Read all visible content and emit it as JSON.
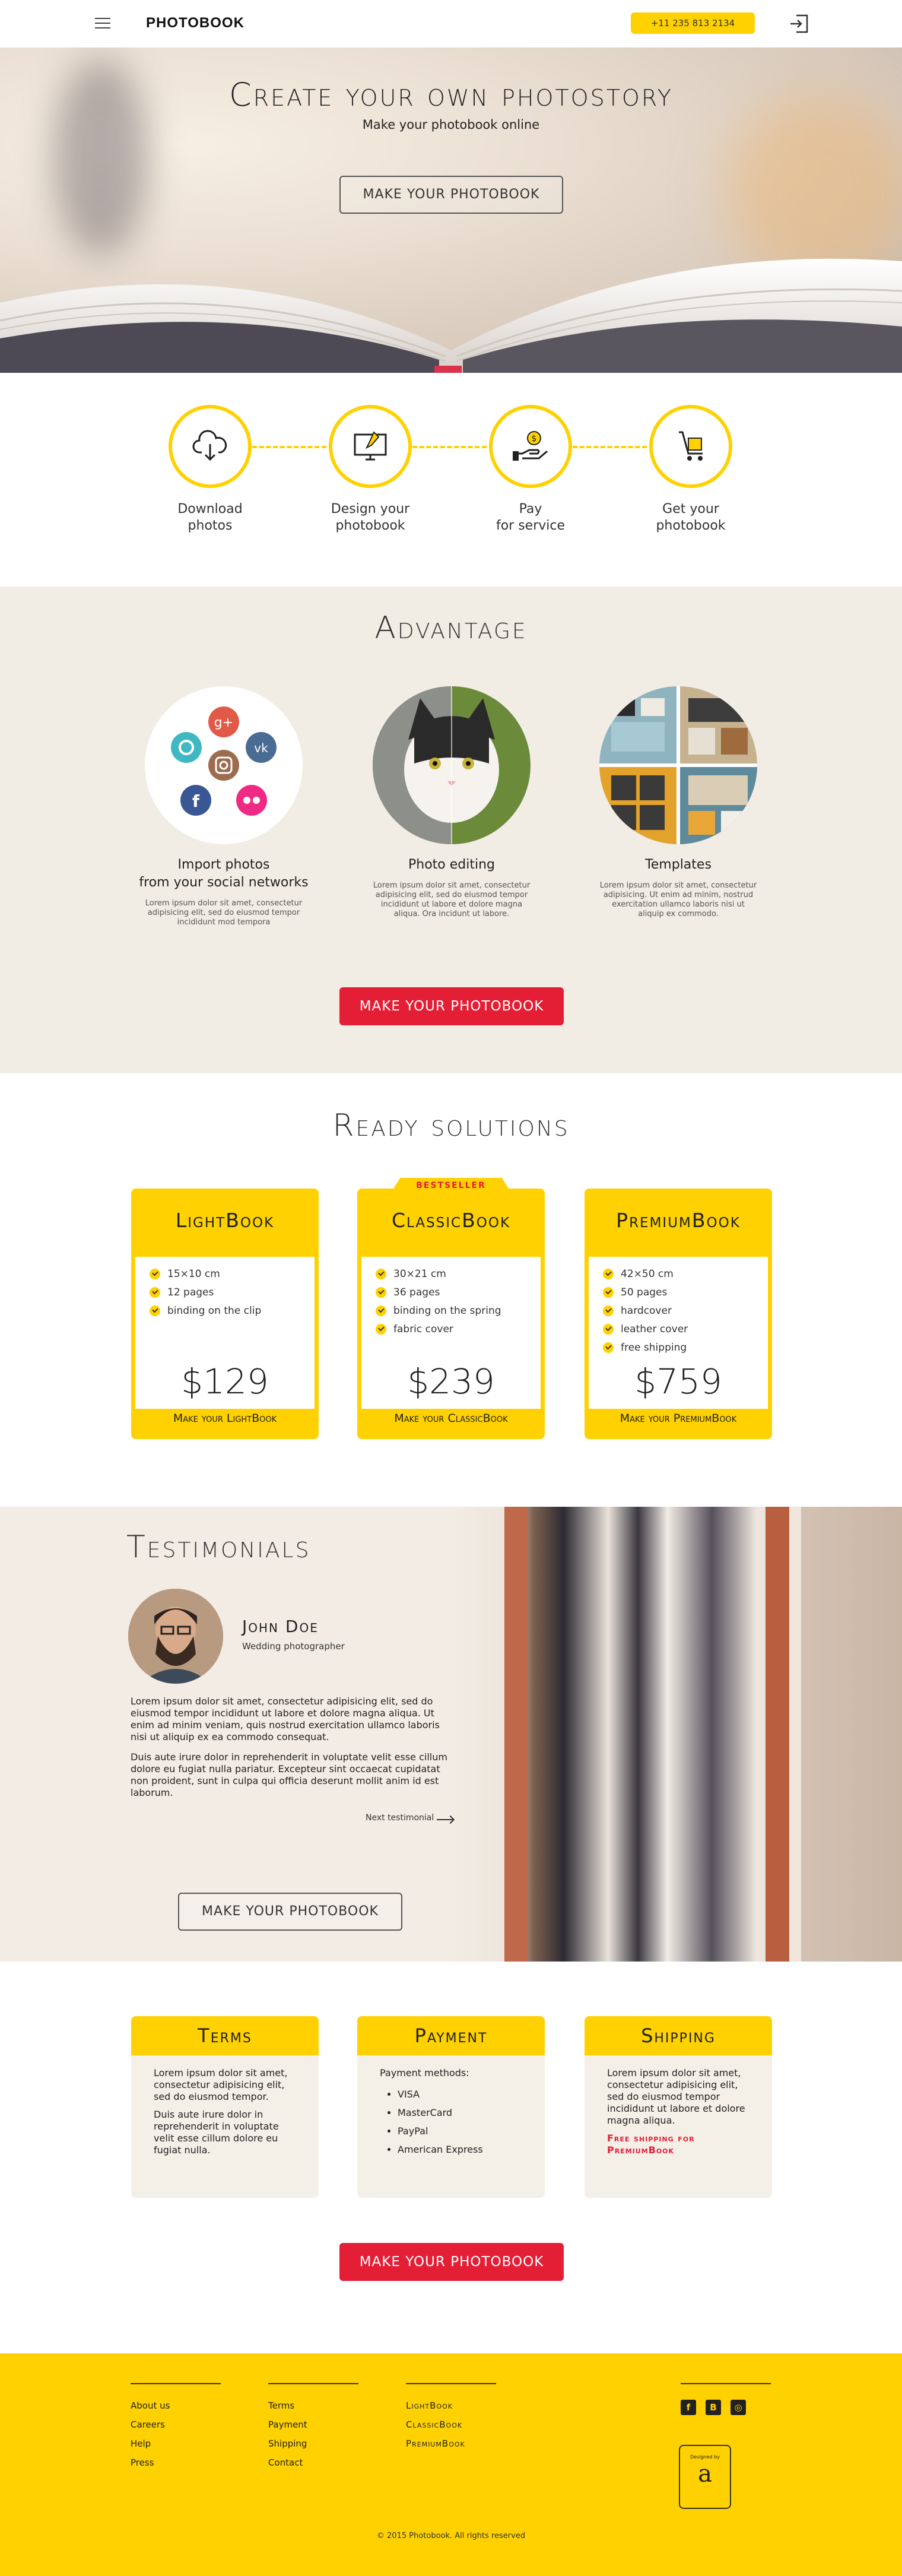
{
  "header": {
    "logo": "PHOTOBOOK",
    "phone": "+11 235 813 2134"
  },
  "hero": {
    "title": "Create your own photostory",
    "subtitle": "Make your photobook online",
    "cta": "MAKE YOUR PHOTOBOOK"
  },
  "steps": [
    {
      "line1": "Download",
      "line2": "photos",
      "icon": "cloud-download-icon"
    },
    {
      "line1": "Design your",
      "line2": "photobook",
      "icon": "monitor-design-icon"
    },
    {
      "line1": "Pay",
      "line2": "for service",
      "icon": "pay-coin-icon"
    },
    {
      "line1": "Get your",
      "line2": "photobook",
      "icon": "delivery-cart-icon"
    }
  ],
  "advantage": {
    "title": "Advantage",
    "items": [
      {
        "title1": "Import photos",
        "title2": "from your social networks",
        "text": "Lorem ipsum dolor sit amet, consectetur adipisicing elit, sed do eiusmod tempor incididunt mod tempora"
      },
      {
        "title1": "Photo editing",
        "title2": "",
        "text": "Lorem ipsum dolor sit amet, consectetur adipisicing elit, sed do eiusmod tempor incididunt ut labore et dolore magna aliqua. Ora incidunt ut labore."
      },
      {
        "title1": "Templates",
        "title2": "",
        "text": "Lorem ipsum dolor sit amet, consectetur adipisicing. Ut enim ad minim, nostrud exercitation ullamco laboris nisi ut aliquip ex commodo."
      }
    ],
    "cta": "MAKE YOUR PHOTOBOOK"
  },
  "ready": {
    "title": "Ready solutions",
    "plans": [
      {
        "name": "LightBook",
        "features": [
          "15×10 cm",
          "12 pages",
          "binding on the clip"
        ],
        "price": "$129",
        "cta": "Make your LightBook",
        "badge": ""
      },
      {
        "name": "ClassicBook",
        "features": [
          "30×21 cm",
          "36 pages",
          "binding on the spring",
          "fabric cover"
        ],
        "price": "$239",
        "cta": "Make your ClassicBook",
        "badge": "BESTSELLER"
      },
      {
        "name": "PremiumBook",
        "features": [
          "42×50 cm",
          "50 pages",
          "hardcover",
          "leather cover",
          "free shipping"
        ],
        "price": "$759",
        "cta": "Make your PremiumBook",
        "badge": ""
      }
    ]
  },
  "testimonials": {
    "title": "Testimonials",
    "author": "John Doe",
    "role": "Wedding photographer",
    "p1": "Lorem ipsum dolor sit amet, consectetur adipisicing elit, sed do eiusmod tempor incididunt ut labore et dolore magna aliqua. Ut enim ad minim veniam, quis nostrud exercitation ullamco laboris nisi ut aliquip ex ea commodo consequat.",
    "p2": "Duis aute irure dolor in reprehenderit in voluptate velit esse cillum dolore eu fugiat nulla pariatur. Excepteur sint occaecat cupidatat non proident, sunt in culpa qui officia deserunt mollit anim id est laborum.",
    "next": "Next testimonial",
    "cta": "MAKE YOUR PHOTOBOOK"
  },
  "info": {
    "terms": {
      "title": "Terms",
      "p1": "Lorem ipsum dolor sit amet, consectetur adipisicing elit, sed do eiusmod tempor.",
      "p2": "Duis aute irure dolor in reprehenderit in voluptate velit esse cillum dolore eu fugiat nulla."
    },
    "payment": {
      "title": "Payment",
      "intro": "Payment methods:",
      "methods": [
        "VISA",
        "MasterCard",
        "PayPal",
        "American Express"
      ]
    },
    "shipping": {
      "title": "Shipping",
      "p1": "Lorem ipsum dolor sit amet, consectetur adipisicing elit, sed do eiusmod tempor incididunt ut labore et dolore magna aliqua.",
      "note1": "Free shipping for",
      "note2": "PremiumBook"
    },
    "cta": "MAKE YOUR PHOTOBOOK"
  },
  "footer": {
    "col1": [
      "About us",
      "Careers",
      "Help",
      "Press"
    ],
    "col2": [
      "Terms",
      "Payment",
      "Shipping",
      "Contact"
    ],
    "col3": [
      "LightBook",
      "ClassicBook",
      "PremiumBook"
    ],
    "social": [
      {
        "icon": "facebook-icon",
        "glyph": "f"
      },
      {
        "icon": "vk-icon",
        "glyph": "B"
      },
      {
        "icon": "instagram-icon",
        "glyph": "◎"
      }
    ],
    "badge_line": "Designed by",
    "badge_letter": "a",
    "copyright": "© 2015 Photobook. All rights reserved"
  },
  "colors": {
    "yellow": "#ffd100",
    "red": "#e31e35",
    "beige": "#f1ede5"
  }
}
